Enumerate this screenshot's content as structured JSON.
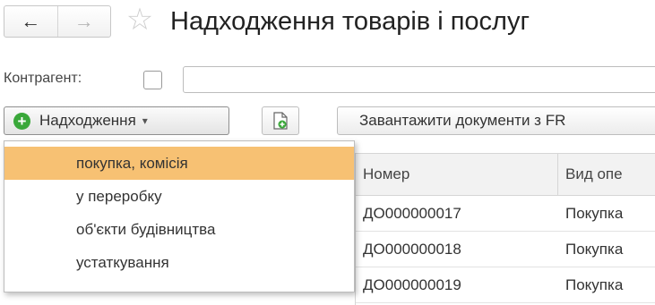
{
  "header": {
    "title": "Надходження товарів і послуг",
    "back_icon": "←",
    "forward_icon": "→",
    "favorite_icon": "☆"
  },
  "filter": {
    "counterparty_label": "Контрагент:",
    "counterparty_value": ""
  },
  "toolbar": {
    "create_label": "Надходження",
    "load_label": "Завантажити документи з FR"
  },
  "dropdown": {
    "items": [
      {
        "label": "покупка, комісія",
        "selected": true
      },
      {
        "label": "у переробку",
        "selected": false
      },
      {
        "label": "об'єкти будівництва",
        "selected": false
      },
      {
        "label": "устаткування",
        "selected": false
      }
    ]
  },
  "table": {
    "columns": [
      "Номер",
      "Вид опе"
    ],
    "rows": [
      {
        "number": "ДО000000017",
        "operation": "Покупка"
      },
      {
        "number": "ДО000000018",
        "operation": "Покупка"
      },
      {
        "number": "ДО000000019",
        "operation": "Покупка"
      }
    ]
  },
  "colors": {
    "accent_green": "#3aa83a",
    "menu_highlight": "#f7c173"
  }
}
